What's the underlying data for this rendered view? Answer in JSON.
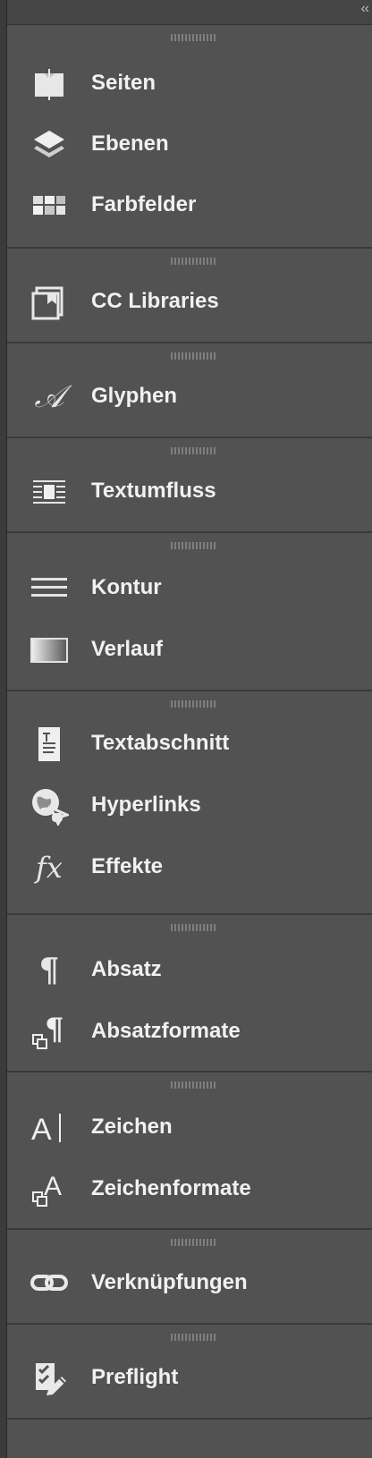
{
  "header": {
    "collapse_icon": "double-chevron-left-icon",
    "collapse_glyph": "‹‹"
  },
  "panels": [
    {
      "items": [
        {
          "label": "Seiten",
          "icon": "pages-icon"
        },
        {
          "label": "Ebenen",
          "icon": "layers-icon"
        },
        {
          "label": "Farbfelder",
          "icon": "swatches-icon"
        }
      ]
    },
    {
      "items": [
        {
          "label": "CC Libraries",
          "icon": "cc-libraries-icon"
        }
      ]
    },
    {
      "items": [
        {
          "label": "Glyphen",
          "icon": "glyphs-icon"
        }
      ]
    },
    {
      "items": [
        {
          "label": "Textumfluss",
          "icon": "text-wrap-icon"
        }
      ]
    },
    {
      "items": [
        {
          "label": "Kontur",
          "icon": "stroke-icon"
        },
        {
          "label": "Verlauf",
          "icon": "gradient-icon"
        }
      ]
    },
    {
      "items": [
        {
          "label": "Textabschnitt",
          "icon": "story-icon"
        },
        {
          "label": "Hyperlinks",
          "icon": "hyperlinks-icon"
        },
        {
          "label": "Effekte",
          "icon": "effects-icon"
        }
      ]
    },
    {
      "items": [
        {
          "label": "Absatz",
          "icon": "paragraph-icon"
        },
        {
          "label": "Absatzformate",
          "icon": "paragraph-styles-icon"
        }
      ]
    },
    {
      "items": [
        {
          "label": "Zeichen",
          "icon": "character-icon"
        },
        {
          "label": "Zeichenformate",
          "icon": "character-styles-icon"
        }
      ]
    },
    {
      "items": [
        {
          "label": "Verknüpfungen",
          "icon": "links-icon"
        }
      ]
    },
    {
      "items": [
        {
          "label": "Preflight",
          "icon": "preflight-icon"
        }
      ]
    }
  ],
  "colors": {
    "panel_bg": "#525252",
    "text": "#f1f1f1",
    "separator": "#3a3a3a"
  }
}
